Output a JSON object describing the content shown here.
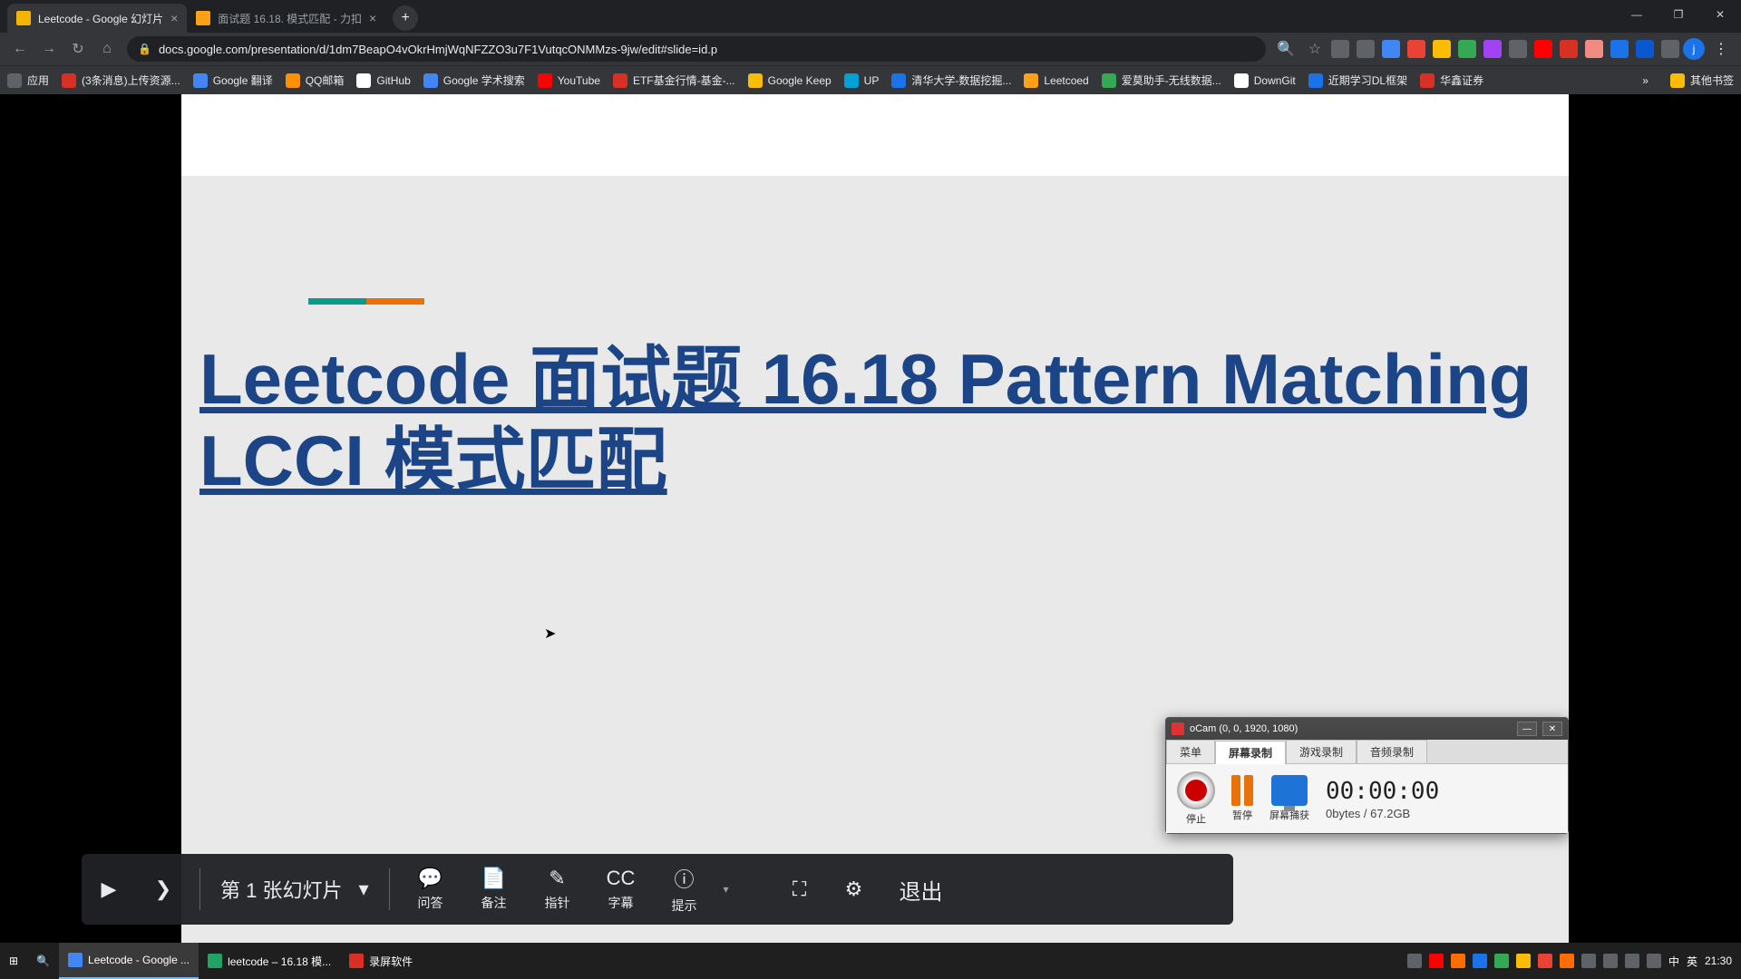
{
  "window": {
    "min": "—",
    "max": "❐",
    "close": "✕"
  },
  "tabs": [
    {
      "title": "Leetcode - Google 幻灯片",
      "active": true,
      "favcolor": "#f4b400"
    },
    {
      "title": "面试题 16.18. 模式匹配 - 力扣",
      "active": false,
      "favcolor": "#ffa116"
    }
  ],
  "newtab": "+",
  "nav": {
    "back": "←",
    "fwd": "→",
    "reload": "↻",
    "home": "⌂"
  },
  "address": {
    "lock": "🔒",
    "url": "docs.google.com/presentation/d/1dm7BeapO4vOkrHmjWqNFZZO3u7F1VutqcONMMzs-9jw/edit#slide=id.p"
  },
  "righticons": [
    {
      "c": "#5f6368"
    },
    {
      "c": "#5f6368"
    },
    {
      "c": "#4285f4"
    },
    {
      "c": "#ea4335"
    },
    {
      "c": "#fbbc04"
    },
    {
      "c": "#34a853"
    },
    {
      "c": "#a142f4"
    },
    {
      "c": "#5f6368"
    },
    {
      "c": "#ff0000"
    },
    {
      "c": "#d93025"
    },
    {
      "c": "#f28b82"
    },
    {
      "c": "#1a73e8"
    },
    {
      "c": "#0b57d0"
    },
    {
      "c": "#5f6368"
    }
  ],
  "avatar": "j",
  "menu": "⋮",
  "appsicon": "⋮⋮⋮",
  "appslabel": "应用",
  "bookmarks": [
    {
      "label": "(3条消息)上传资源...",
      "c": "#d93025"
    },
    {
      "label": "Google 翻译",
      "c": "#4285f4"
    },
    {
      "label": "QQ邮箱",
      "c": "#ff9100"
    },
    {
      "label": "GitHub",
      "c": "#ffffff"
    },
    {
      "label": "Google 学术搜索",
      "c": "#4285f4"
    },
    {
      "label": "YouTube",
      "c": "#ff0000"
    },
    {
      "label": "ETF基金行情-基金-...",
      "c": "#d93025"
    },
    {
      "label": "Google Keep",
      "c": "#fbbc04"
    },
    {
      "label": "UP",
      "c": "#00a1d6"
    },
    {
      "label": "清华大学-数据挖掘...",
      "c": "#1a73e8"
    },
    {
      "label": "Leetcoed",
      "c": "#ffa116"
    },
    {
      "label": "爱莫助手-无线数据...",
      "c": "#34a853"
    },
    {
      "label": "DownGit",
      "c": "#ffffff"
    },
    {
      "label": "近期学习DL框架",
      "c": "#1a73e8"
    },
    {
      "label": "华鑫证券",
      "c": "#d93025"
    }
  ],
  "bmmore": "»",
  "bmother": "其他书签",
  "slide": {
    "title": "Leetcode 面试题 16.18 Pattern Matching LCCI 模式匹配"
  },
  "present": {
    "play": "▶",
    "next": "❯",
    "slidelabel": "第 1 张幻灯片",
    "dd": "▾",
    "tools": [
      {
        "icon": "💬",
        "label": "问答"
      },
      {
        "icon": "📄",
        "label": "备注"
      },
      {
        "icon": "✎",
        "label": "指针"
      },
      {
        "icon": "CC",
        "label": "字幕"
      },
      {
        "icon": "ⓘ",
        "label": "提示"
      }
    ],
    "dd2": "▾",
    "full": "⛶",
    "gear": "⚙",
    "exit": "退出"
  },
  "ocam": {
    "title": "oCam (0, 0, 1920, 1080)",
    "min": "—",
    "close": "✕",
    "tabs": [
      "菜单",
      "屏幕录制",
      "游戏录制",
      "音频录制"
    ],
    "activeTab": 1,
    "stop": "停止",
    "pause": "暂停",
    "capture": "屏幕捕获",
    "timer": "00:00:00",
    "size": "0bytes / 67.2GB"
  },
  "taskbar": {
    "start": "⊞",
    "search": "🔍",
    "apps": [
      {
        "label": "Leetcode - Google ...",
        "c": "#4285f4",
        "active": true
      },
      {
        "label": "leetcode – 16.18 模...",
        "c": "#21a366",
        "active": false
      },
      {
        "label": "录屏软件",
        "c": "#d93025",
        "active": false
      }
    ],
    "tray": [
      {
        "c": "#5f6368"
      },
      {
        "c": "#ff0000"
      },
      {
        "c": "#ff6d00"
      },
      {
        "c": "#1a73e8"
      },
      {
        "c": "#34a853"
      },
      {
        "c": "#fbbc04"
      },
      {
        "c": "#ea4335"
      },
      {
        "c": "#ff6d00"
      },
      {
        "c": "#5f6368"
      },
      {
        "c": "#5f6368"
      },
      {
        "c": "#5f6368"
      },
      {
        "c": "#5f6368"
      }
    ],
    "ime1": "中",
    "ime2": "英",
    "clock": "21:30"
  }
}
